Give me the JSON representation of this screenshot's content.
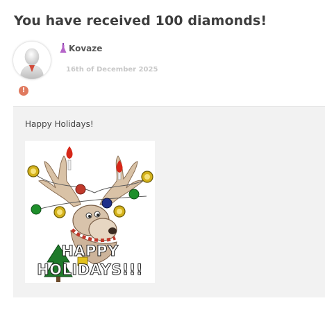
{
  "page": {
    "title": "You have received 100 diamonds!"
  },
  "author": {
    "name": "Kovaze",
    "date": "16th of December 2025",
    "warning_glyph": "!"
  },
  "message": {
    "text": "Happy Holidays!",
    "gif_text_line1": "HAPPY",
    "gif_text_line2": "HOLIDAYS!!!"
  },
  "colors": {
    "title": "#3d3d3d",
    "card_bg": "#f2f2f2",
    "warning": "#e07a5f",
    "potion": "#b565c9"
  },
  "icons": {
    "avatar": "default-avatar-icon",
    "badge": "potion-flask-icon",
    "warning": "warning-icon"
  }
}
